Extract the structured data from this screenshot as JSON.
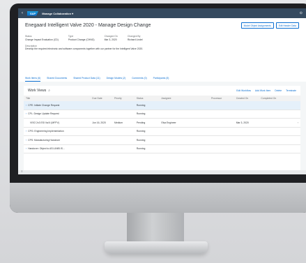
{
  "shell": {
    "back_glyph": "‹",
    "logo": "SAP",
    "title": "Manage Collaboration ▾",
    "right_icon": "⊙"
  },
  "header": {
    "title": "Enegaard Intelligent Valve 2020 - Manage Design Change",
    "actions": [
      "Model Object Assignments",
      "Edit Header Data"
    ],
    "attributes": [
      {
        "label": "Status",
        "value": "Change Impact Evaluation (CD)"
      },
      {
        "label": "Type",
        "value": "Product Change (CHNG)"
      },
      {
        "label": "Changed On",
        "value": "Mar 3, 2020"
      },
      {
        "label": "Changed By",
        "value": "Richard Lindel"
      }
    ],
    "description_label": "Description",
    "description": "Develop the required electronic and software components together with our partner for the Intelligent Valve 2020.",
    "tabs": [
      "Work Items (6)",
      "Shared Documents",
      "Shared Product Data (11)",
      "Design Models (2)",
      "Comments (0)",
      "Participants (5)"
    ]
  },
  "table": {
    "title": "Work Views",
    "actions": [
      "Edit Workflow",
      "Add Work Item",
      "Delete",
      "Terminate"
    ],
    "columns": [
      "Title",
      "Due Date",
      "Priority",
      "Status",
      "Assignee",
      "Processor",
      "Created On",
      "Completed On",
      ""
    ],
    "rows": [
      {
        "title": "CPE: Initiate Change Request",
        "due": "",
        "priority": "",
        "status": "Running",
        "assignee": "",
        "processor": "",
        "created": "",
        "completed": "",
        "expandable": true,
        "selected": true
      },
      {
        "title": "CPL: Design Update Request",
        "due": "",
        "priority": "",
        "status": "Running",
        "assignee": "",
        "processor": "",
        "created": "",
        "completed": "",
        "expandable": true,
        "selected": false
      },
      {
        "title": "VISO 2x3 ESI Val II (MFPV)",
        "due": "Jun 16, 2020",
        "priority": "Medium",
        "status": "Pending",
        "assignee": "Elsa Engineer",
        "processor": "",
        "created": "Mar 3, 2020",
        "completed": "",
        "expandable": false,
        "selected": false
      },
      {
        "title": "CPG: Engineering Implementation",
        "due": "",
        "priority": "",
        "status": "Running",
        "assignee": "",
        "processor": "",
        "created": "",
        "completed": "",
        "expandable": true,
        "selected": false
      },
      {
        "title": "CPS: Manufacturing Handover",
        "due": "",
        "priority": "",
        "status": "Running",
        "assignee": "",
        "processor": "",
        "created": "",
        "completed": "",
        "expandable": true,
        "selected": false
      },
      {
        "title": "Handover: Object to ASI-UNIB IS...",
        "due": "",
        "priority": "",
        "status": "Running",
        "assignee": "",
        "processor": "",
        "created": "",
        "completed": "",
        "expandable": true,
        "selected": false
      }
    ]
  },
  "footer_glyph": "☰"
}
